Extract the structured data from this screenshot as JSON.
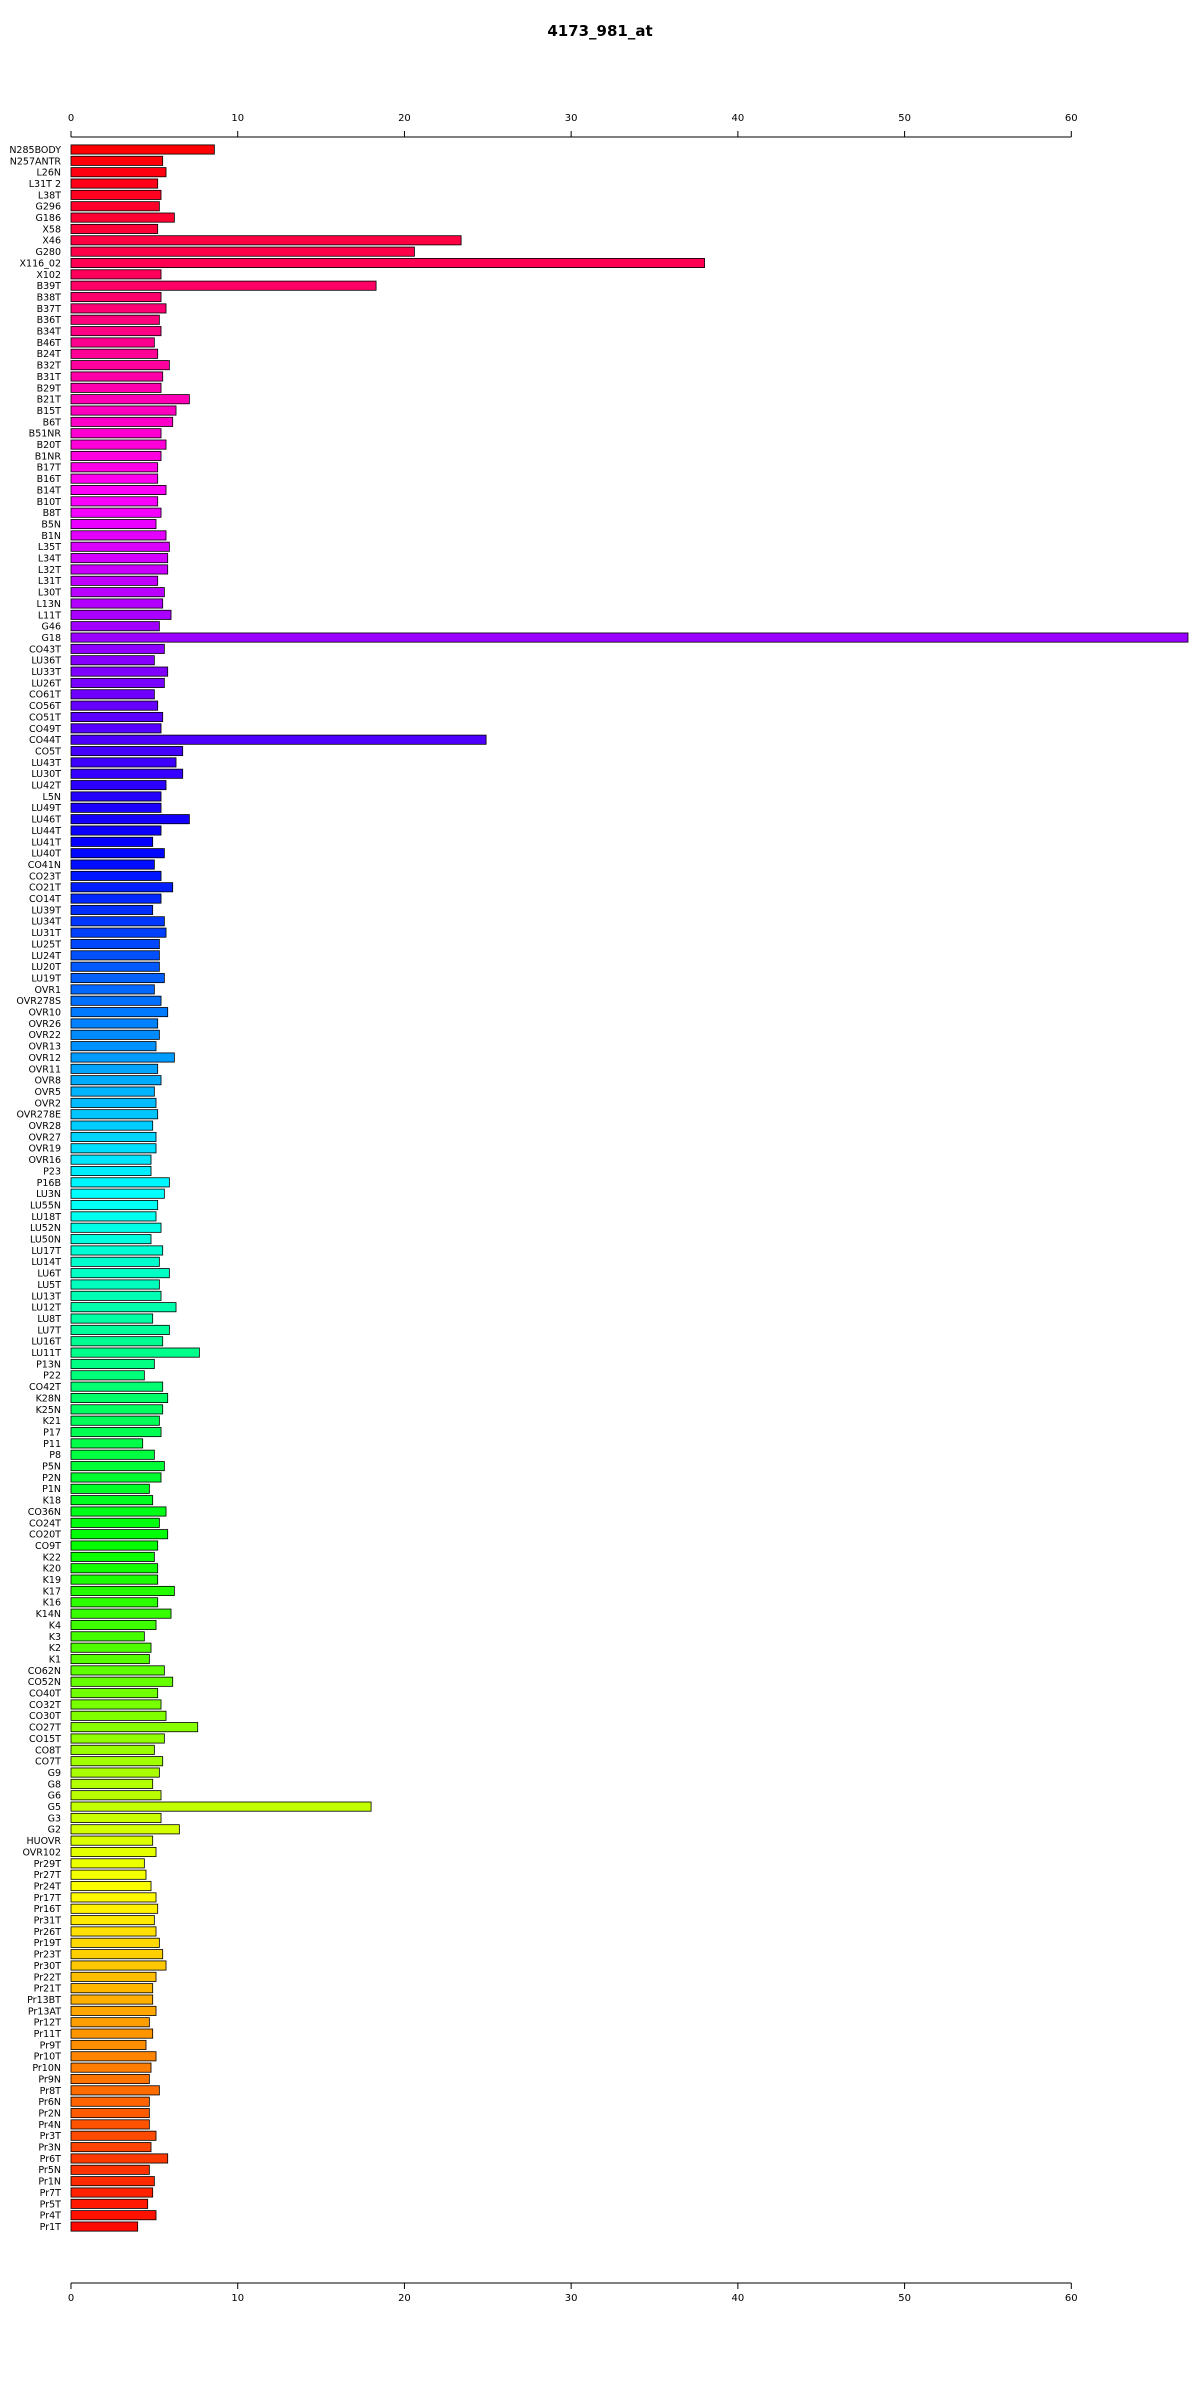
{
  "chart_data": {
    "type": "bar",
    "orientation": "horizontal",
    "title": "4173_981_at",
    "xlabel": "",
    "ylabel": "",
    "xlim": [
      0,
      67
    ],
    "xticks": [
      0,
      10,
      20,
      30,
      40,
      50,
      60
    ],
    "grid": false,
    "legend": "none",
    "color_scheme": "rainbow",
    "categories": [
      "N285BODY",
      "N257ANTR",
      "L26N",
      "L31T 2",
      "L38T",
      "G296",
      "G186",
      "X58",
      "X46",
      "G280",
      "X116_02",
      "X102",
      "B39T",
      "B38T",
      "B37T",
      "B36T",
      "B34T",
      "B46T",
      "B24T",
      "B32T",
      "B31T",
      "B29T",
      "B21T",
      "B15T",
      "B6T",
      "B51NR",
      "B20T",
      "B1NR",
      "B17T",
      "B16T",
      "B14T",
      "B10T",
      "B8T",
      "B5N",
      "B1N",
      "L35T",
      "L34T",
      "L32T",
      "L31T",
      "L30T",
      "L13N",
      "L11T",
      "G46",
      "G18",
      "CO43T",
      "LU36T",
      "LU33T",
      "LU26T",
      "CO61T",
      "CO56T",
      "CO51T",
      "CO49T",
      "CO44T",
      "CO5T",
      "LU43T",
      "LU30T",
      "LU42T",
      "L5N",
      "LU49T",
      "LU46T",
      "LU44T",
      "LU41T",
      "LU40T",
      "CO41N",
      "CO23T",
      "CO21T",
      "CO14T",
      "LU39T",
      "LU34T",
      "LU31T",
      "LU25T",
      "LU24T",
      "LU20T",
      "LU19T",
      "OVR1",
      "OVR278S",
      "OVR10",
      "OVR26",
      "OVR22",
      "OVR13",
      "OVR12",
      "OVR11",
      "OVR8",
      "OVR5",
      "OVR2",
      "OVR278E",
      "OVR28",
      "OVR27",
      "OVR19",
      "OVR16",
      "P23",
      "P16B",
      "LU3N",
      "LU55N",
      "LU18T",
      "LU52N",
      "LU50N",
      "LU17T",
      "LU14T",
      "LU6T",
      "LU5T",
      "LU13T",
      "LU12T",
      "LU8T",
      "LU7T",
      "LU16T",
      "LU11T",
      "P13N",
      "P22",
      "CO42T",
      "K28N",
      "K25N",
      "K21",
      "P17",
      "P11",
      "P8",
      "P5N",
      "P2N",
      "P1N",
      "K18",
      "CO36N",
      "CO24T",
      "CO20T",
      "CO9T",
      "K22",
      "K20",
      "K19",
      "K17",
      "K16",
      "K14N",
      "K4",
      "K3",
      "K2",
      "K1",
      "CO62N",
      "CO52N",
      "CO40T",
      "CO32T",
      "CO30T",
      "CO27T",
      "CO15T",
      "CO8T",
      "CO7T",
      "G9",
      "G8",
      "G6",
      "G5",
      "G3",
      "G2",
      "HUOVR",
      "OVR102",
      "Pr29T",
      "Pr27T",
      "Pr24T",
      "Pr17T",
      "Pr16T",
      "Pr31T",
      "Pr26T",
      "Pr19T",
      "Pr23T",
      "Pr30T",
      "Pr22T",
      "Pr21T",
      "Pr13BT",
      "Pr13AT",
      "Pr12T",
      "Pr11T",
      "Pr9T",
      "Pr10T",
      "Pr10N",
      "Pr9N",
      "Pr8T",
      "Pr6N",
      "Pr2N",
      "Pr4N",
      "Pr3T",
      "Pr3N",
      "Pr6T",
      "Pr5N",
      "Pr1N",
      "Pr7T",
      "Pr5T",
      "Pr4T",
      "Pr1T"
    ],
    "values": [
      8.6,
      5.5,
      5.7,
      5.2,
      5.4,
      5.3,
      6.2,
      5.2,
      23.4,
      20.6,
      38.0,
      5.4,
      18.3,
      5.4,
      5.7,
      5.3,
      5.4,
      5.0,
      5.2,
      5.9,
      5.5,
      5.4,
      7.1,
      6.3,
      6.1,
      5.4,
      5.7,
      5.4,
      5.2,
      5.2,
      5.7,
      5.2,
      5.4,
      5.1,
      5.7,
      5.9,
      5.8,
      5.8,
      5.2,
      5.6,
      5.5,
      6.0,
      5.3,
      67.0,
      5.6,
      5.0,
      5.8,
      5.6,
      5.0,
      5.2,
      5.5,
      5.4,
      24.9,
      6.7,
      6.3,
      6.7,
      5.7,
      5.4,
      5.4,
      7.1,
      5.4,
      4.9,
      5.6,
      5.0,
      5.4,
      6.1,
      5.4,
      4.9,
      5.6,
      5.7,
      5.3,
      5.3,
      5.3,
      5.6,
      5.0,
      5.4,
      5.8,
      5.2,
      5.3,
      5.1,
      6.2,
      5.2,
      5.4,
      5.0,
      5.1,
      5.2,
      4.9,
      5.1,
      5.1,
      4.8,
      4.8,
      5.9,
      5.6,
      5.2,
      5.1,
      5.4,
      4.8,
      5.5,
      5.3,
      5.9,
      5.3,
      5.4,
      6.3,
      4.9,
      5.9,
      5.5,
      7.7,
      5.0,
      4.4,
      5.5,
      5.8,
      5.5,
      5.3,
      5.4,
      4.3,
      5.0,
      5.6,
      5.4,
      4.7,
      4.9,
      5.7,
      5.3,
      5.8,
      5.2,
      5.0,
      5.2,
      5.2,
      6.2,
      5.2,
      6.0,
      5.1,
      4.4,
      4.8,
      4.7,
      5.6,
      6.1,
      5.2,
      5.4,
      5.7,
      7.6,
      5.6,
      5.0,
      5.5,
      5.3,
      4.9,
      5.4,
      18.0,
      5.4,
      6.5,
      4.9,
      5.1,
      4.4,
      4.5,
      4.8,
      5.1,
      5.2,
      5.0,
      5.1,
      5.3,
      5.5,
      5.7,
      5.1,
      4.9,
      4.9,
      5.1,
      4.7,
      4.9,
      4.5,
      5.1,
      4.8,
      4.7,
      5.3,
      4.7,
      4.7,
      4.7,
      5.1,
      4.8,
      5.8,
      4.7,
      5.0,
      4.9,
      4.6,
      5.1,
      4.0
    ]
  }
}
